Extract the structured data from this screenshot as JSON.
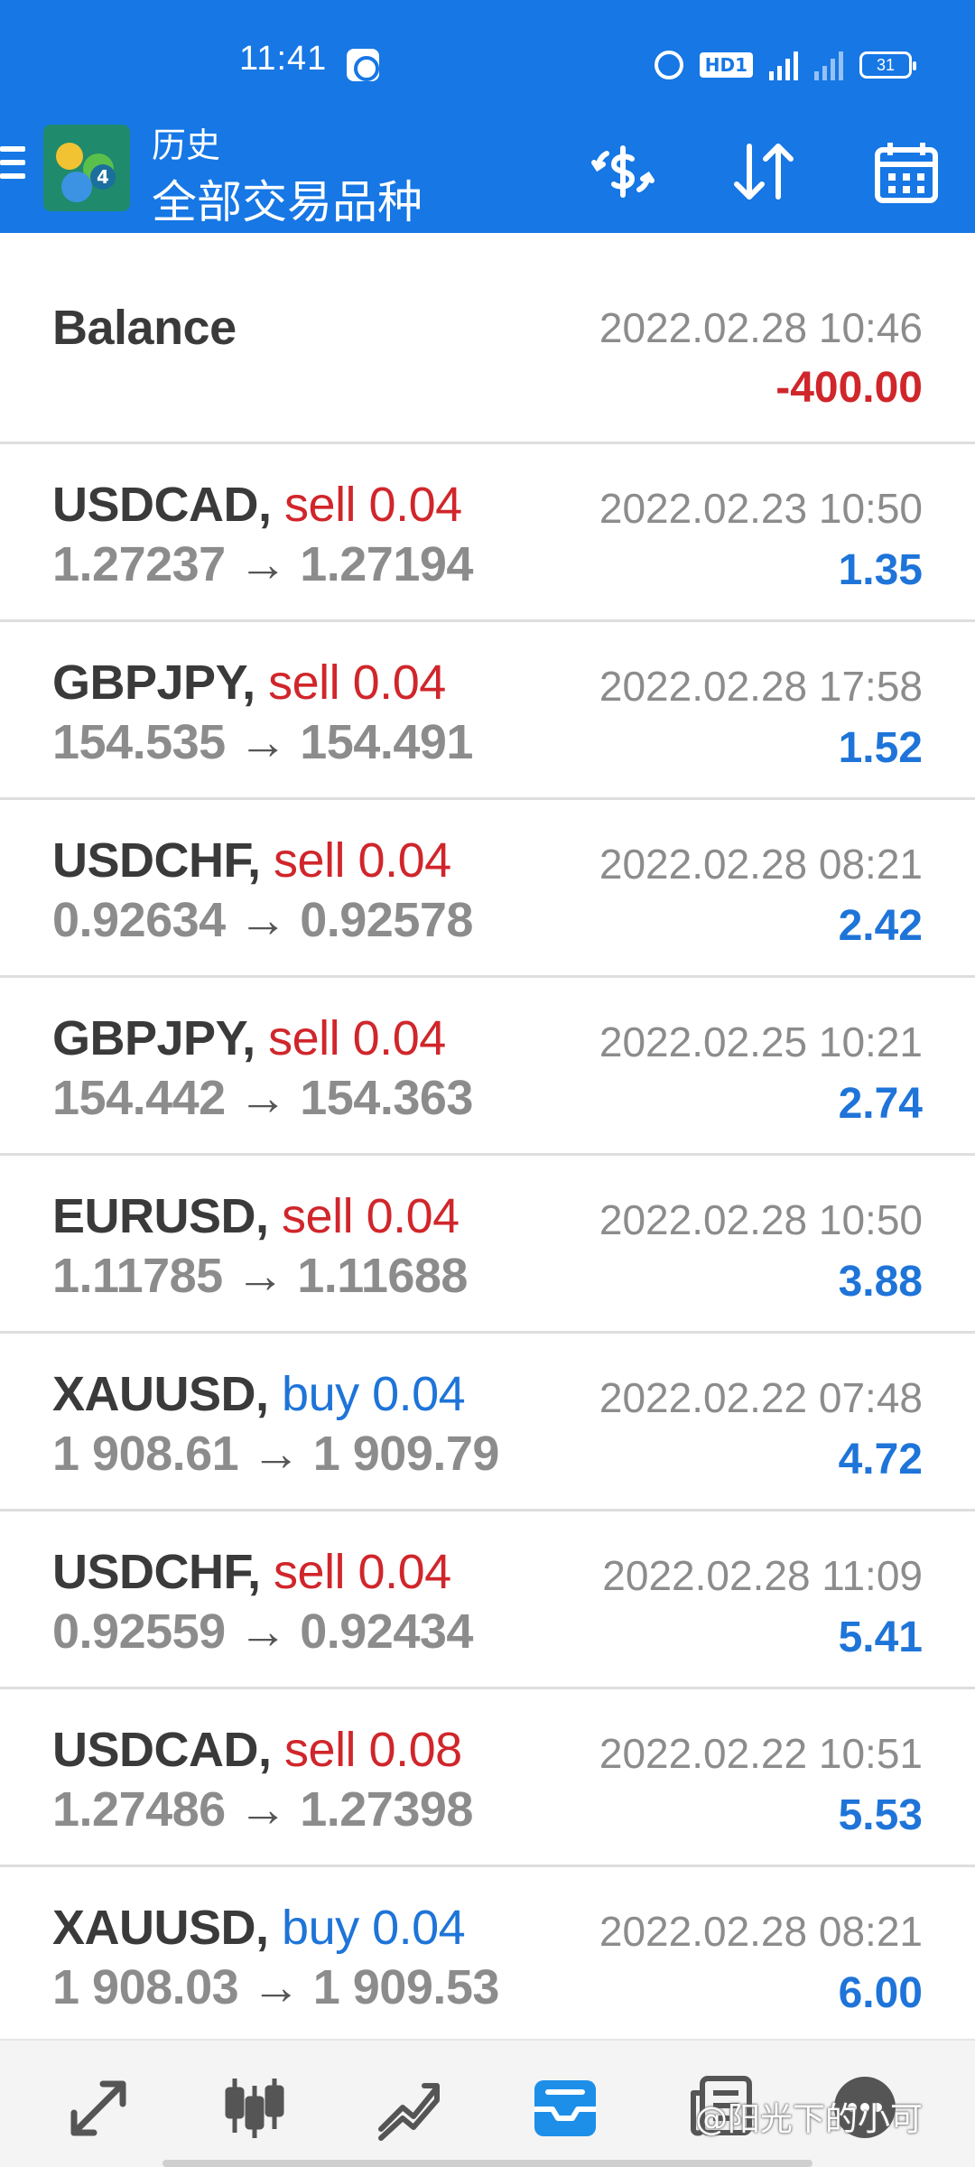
{
  "status_bar": {
    "time": "11:41",
    "hd_label": "HD1",
    "network": "4G",
    "battery": "31"
  },
  "header": {
    "title": "历史",
    "subtitle": "全部交易品种",
    "icons": [
      "currency-icon",
      "sort-icon",
      "calendar-icon"
    ],
    "background_color": "#1677e5"
  },
  "balance": {
    "label": "Balance",
    "date": "2022.02.28 10:46",
    "amount": "-400.00"
  },
  "trades": [
    {
      "symbol": "USDCAD,",
      "side": "sell 0.04",
      "type": "sell",
      "open": "1.27237",
      "close": "1.27194",
      "date": "2022.02.23 10:50",
      "profit": "1.35"
    },
    {
      "symbol": "GBPJPY,",
      "side": "sell 0.04",
      "type": "sell",
      "open": "154.535",
      "close": "154.491",
      "date": "2022.02.28 17:58",
      "profit": "1.52"
    },
    {
      "symbol": "USDCHF,",
      "side": "sell 0.04",
      "type": "sell",
      "open": "0.92634",
      "close": "0.92578",
      "date": "2022.02.28 08:21",
      "profit": "2.42"
    },
    {
      "symbol": "GBPJPY,",
      "side": "sell 0.04",
      "type": "sell",
      "open": "154.442",
      "close": "154.363",
      "date": "2022.02.25 10:21",
      "profit": "2.74"
    },
    {
      "symbol": "EURUSD,",
      "side": "sell 0.04",
      "type": "sell",
      "open": "1.11785",
      "close": "1.11688",
      "date": "2022.02.28 10:50",
      "profit": "3.88"
    },
    {
      "symbol": "XAUUSD,",
      "side": "buy 0.04",
      "type": "buy",
      "open": "1 908.61",
      "close": "1 909.79",
      "date": "2022.02.22 07:48",
      "profit": "4.72"
    },
    {
      "symbol": "USDCHF,",
      "side": "sell 0.04",
      "type": "sell",
      "open": "0.92559",
      "close": "0.92434",
      "date": "2022.02.28 11:09",
      "profit": "5.41"
    },
    {
      "symbol": "USDCAD,",
      "side": "sell 0.08",
      "type": "sell",
      "open": "1.27486",
      "close": "1.27398",
      "date": "2022.02.22 10:51",
      "profit": "5.53"
    },
    {
      "symbol": "XAUUSD,",
      "side": "buy 0.04",
      "type": "buy",
      "open": "1 908.03",
      "close": "1 909.53",
      "date": "2022.02.28 08:21",
      "profit": "6.00"
    }
  ],
  "arrow_glyph": "→",
  "colors": {
    "sell": "#d0262b",
    "buy": "#1e74d8",
    "profit": "#1e74d8",
    "loss": "#d0262b",
    "active_nav": "#1e8fe8"
  },
  "bottom_nav": [
    "quotes-icon",
    "chart-icon",
    "trade-icon",
    "history-icon",
    "news-icon",
    "chat-icon"
  ],
  "watermark": "@阳光下的小可"
}
